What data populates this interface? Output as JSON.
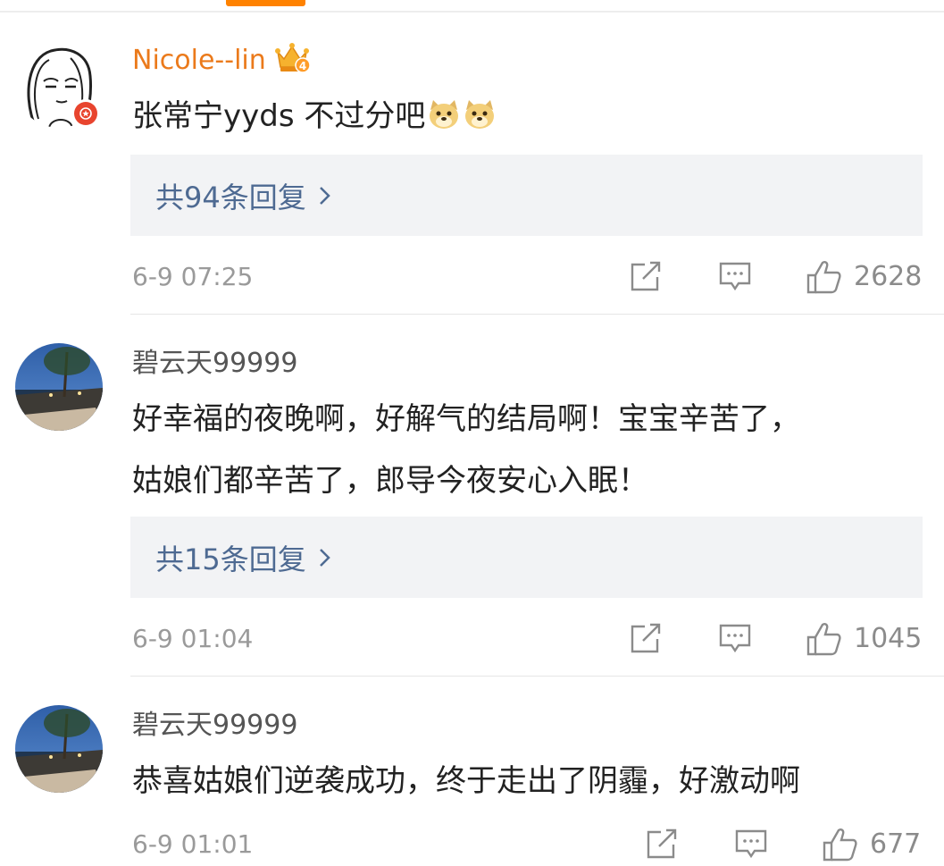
{
  "colors": {
    "accent_orange": "#ff8200",
    "vip_name": "#eb7a1b",
    "reply_link": "#4e6a92",
    "reply_bg": "#f2f3f5",
    "meta_gray": "#9a9a9a"
  },
  "comments": [
    {
      "username": "Nicole--lin",
      "badge": "crown-level-4",
      "text": "张常宁yyds 不过分吧",
      "emojis": [
        "doge",
        "doge"
      ],
      "reply_link": "共94条回复",
      "time": "6-9 07:25",
      "likes": "2628"
    },
    {
      "username": "碧云天99999",
      "text_line1": "好幸福的夜晚啊，好解气的结局啊！宝宝辛苦了，",
      "text_line2": "姑娘们都辛苦了，郎导今夜安心入眠！",
      "reply_link": "共15条回复",
      "time": "6-9 01:04",
      "likes": "1045"
    },
    {
      "username": "碧云天99999",
      "text": "恭喜姑娘们逆袭成功，终于走出了阴霾，好激动啊",
      "time": "6-9 01:01",
      "likes": "677"
    }
  ],
  "icons": [
    "share-icon",
    "comment-icon",
    "like-icon",
    "chevron-right-icon",
    "crown-icon",
    "doge-emoji",
    "vip-star-icon"
  ]
}
